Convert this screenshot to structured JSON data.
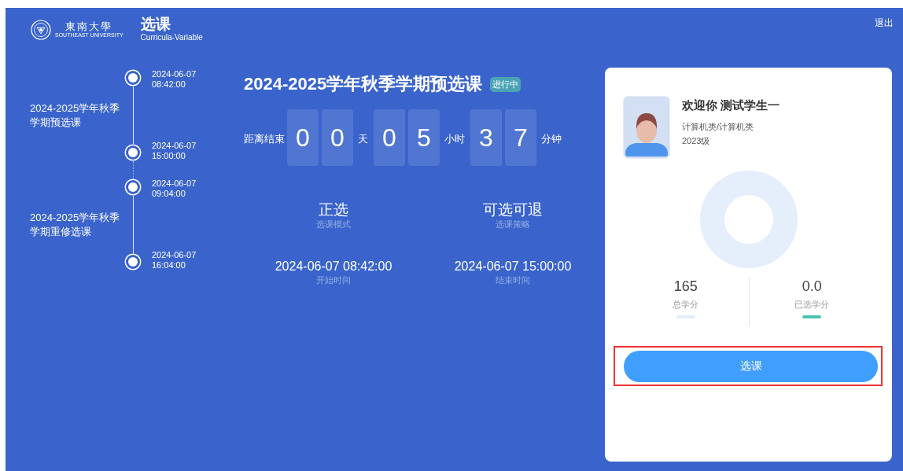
{
  "header": {
    "logo_text": "東南大學",
    "logo_subtext": "SOUTHEAST UNIVERSITY",
    "title": "选课",
    "subtitle": "Curricula-Variable",
    "logout": "退出"
  },
  "timeline": [
    {
      "name": "2024-2025学年秋季学期预选课",
      "start": "2024-06-07\n08:42:00",
      "end": "2024-06-07\n15:00:00"
    },
    {
      "name": "2024-2025学年秋季学期重修选课",
      "start": "2024-06-07\n09:04:00",
      "end": "2024-06-07\n16:04:00"
    }
  ],
  "current": {
    "title": "2024-2025学年秋季学期预选课",
    "status": "进行中",
    "countdown_label": "距离结束",
    "countdown": [
      {
        "digits": [
          "0",
          "0"
        ],
        "unit": "天"
      },
      {
        "digits": [
          "0",
          "5"
        ],
        "unit": "小时"
      },
      {
        "digits": [
          "3",
          "7"
        ],
        "unit": "分钟"
      }
    ],
    "info": [
      {
        "value": "正选",
        "label": "选课模式"
      },
      {
        "value": "可选可退",
        "label": "选课策略"
      },
      {
        "value": "2024-06-07 08:42:00",
        "label": "开始时间"
      },
      {
        "value": "2024-06-07 15:00:00",
        "label": "结束时间"
      }
    ]
  },
  "profile": {
    "greeting": "欢迎你 测试学生一",
    "major": "计算机类/计算机类",
    "grade": "2023级"
  },
  "credits": [
    {
      "value": "165",
      "label": "总学分",
      "color": "#e3edfb"
    },
    {
      "value": "0.0",
      "label": "已选学分",
      "color": "#4cc4b5"
    }
  ],
  "select_button": {
    "label": "选课",
    "highlighted": true
  }
}
